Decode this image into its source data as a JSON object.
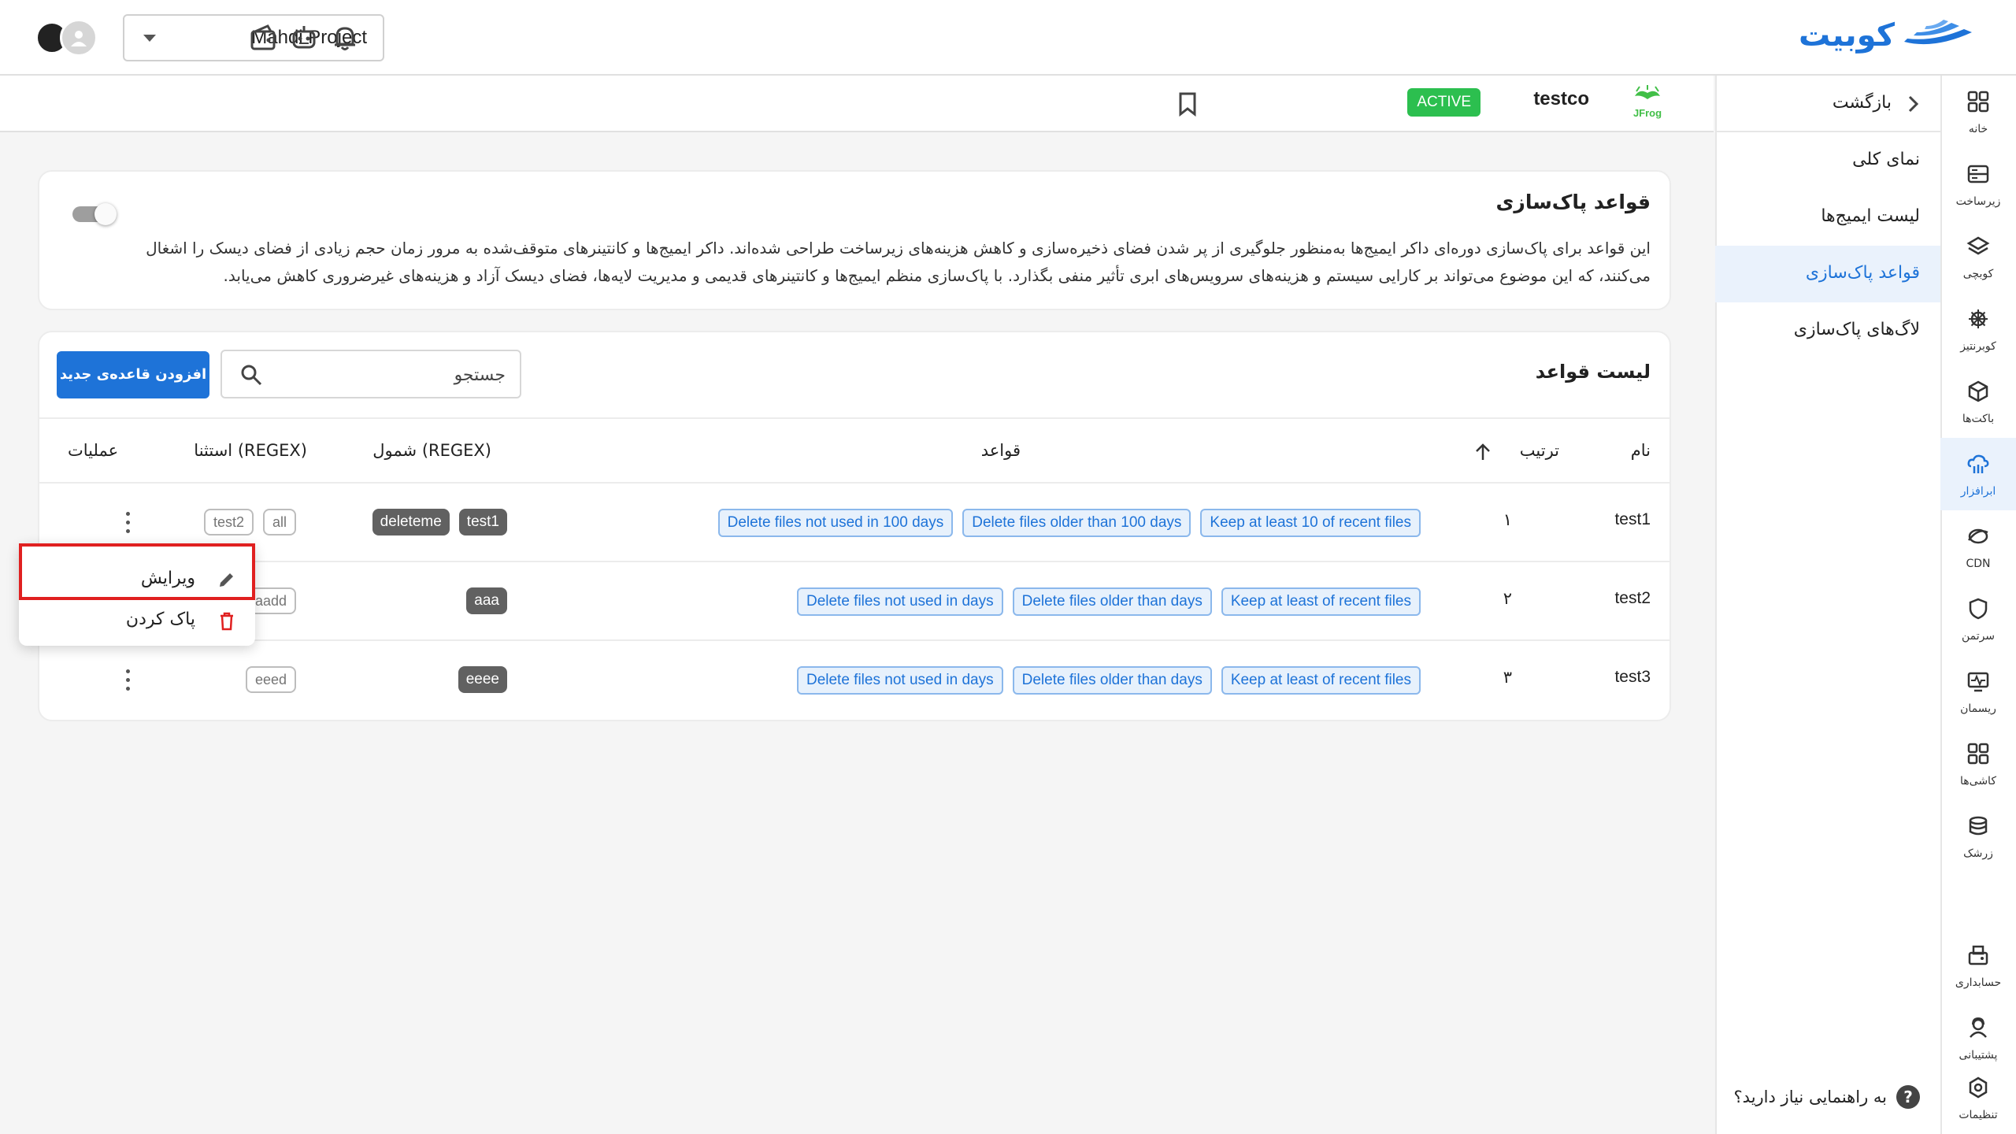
{
  "brand": {
    "name": "کوبیت",
    "color": "#1e73d8"
  },
  "topbar": {
    "project": "Mahdi Project",
    "icons": [
      "wallet-icon",
      "robot-icon",
      "bell-icon"
    ]
  },
  "registry": {
    "name": "testco",
    "status": "ACTIVE",
    "status_color": "#2cbf4f"
  },
  "rail": {
    "items": [
      {
        "label": "خانه",
        "icon": "home-icon"
      },
      {
        "label": "زیرساخت",
        "icon": "server-icon"
      },
      {
        "label": "کوبچی",
        "icon": "layers-icon"
      },
      {
        "label": "کوبرنتیز",
        "icon": "helm-icon"
      },
      {
        "label": "باکت‌ها",
        "icon": "cube-icon"
      },
      {
        "label": "ابرافزار",
        "icon": "cloud-app-icon"
      },
      {
        "label": "CDN",
        "icon": "cdn-icon"
      },
      {
        "label": "سرتمن",
        "icon": "shield-icon"
      },
      {
        "label": "ریسمان",
        "icon": "monitor-icon"
      },
      {
        "label": "کاشی‌ها",
        "icon": "tiles-icon"
      },
      {
        "label": "زرشک",
        "icon": "stack-icon"
      },
      {
        "label": "حسابداری",
        "icon": "billing-icon"
      },
      {
        "label": "پشتیبانی",
        "icon": "support-icon"
      },
      {
        "label": "تنظیمات",
        "icon": "gear-icon"
      }
    ]
  },
  "sidebar": {
    "back": "بازگشت",
    "items": [
      {
        "label": "نمای کلی"
      },
      {
        "label": "لیست ایمیج‌ها"
      },
      {
        "label": "قواعد پاک‌سازی"
      },
      {
        "label": "لاگ‌های پاک‌سازی"
      }
    ],
    "help": "به راهنمایی نیاز دارید؟"
  },
  "intro": {
    "title": "قواعد پاک‌سازی",
    "description": "این قواعد برای پاک‌سازی دوره‌ای داکر ایمیج‌ها به‌منظور جلوگیری از پر شدن فضای ذخیره‌سازی و کاهش هزینه‌های زیرساخت طراحی شده‌اند. داکر ایمیج‌ها و کانتینرهای متوقف‌شده به مرور زمان حجم زیادی از فضای دیسک را اشغال می‌کنند، که این موضوع می‌تواند بر کارایی سیستم و هزینه‌های سرویس‌های ابری تأثیر منفی بگذارد. با پاک‌سازی منظم ایمیج‌ها و کانتینرهای قدیمی و مدیریت لایه‌ها، فضای دیسک آزاد و هزینه‌های غیرضروری کاهش می‌یابد."
  },
  "rules": {
    "title": "لیست قواعد",
    "add_button": "افزودن قاعده‌ی جدید",
    "search_placeholder": "جستجو",
    "columns": {
      "name": "نام",
      "order": "ترتیب",
      "rules": "قواعد",
      "include": "شمول (REGEX)",
      "exclude": "استثنا (REGEX)",
      "actions": "عملیات"
    },
    "rows": [
      {
        "name": "test1",
        "order": "۱",
        "rules": [
          "Delete files not used in 100 days",
          "Delete files older than 100 days",
          "Keep at least 10 of recent files"
        ],
        "include": [
          "deleteme",
          "test1"
        ],
        "exclude": [
          "test2",
          "all"
        ]
      },
      {
        "name": "test2",
        "order": "۲",
        "rules": [
          "Delete files not used in days",
          "Delete files older than days",
          "Keep at least of recent files"
        ],
        "include": [
          "aaa"
        ],
        "exclude": [
          "aadd"
        ]
      },
      {
        "name": "test3",
        "order": "۳",
        "rules": [
          "Delete files not used in days",
          "Delete files older than days",
          "Keep at least of recent files"
        ],
        "include": [
          "eeee"
        ],
        "exclude": [
          "eeed"
        ]
      }
    ]
  },
  "menu": {
    "edit": "ویرایش",
    "delete": "پاک کردن"
  }
}
